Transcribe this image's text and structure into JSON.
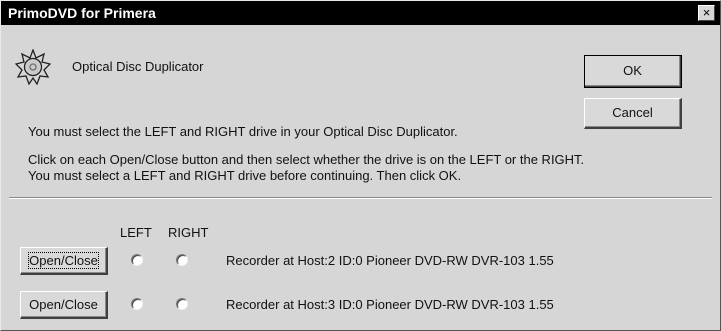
{
  "window": {
    "title": "PrimoDVD for Primera",
    "close_glyph": "×"
  },
  "header": {
    "icon": "starburst-disc-icon",
    "label": "Optical Disc Duplicator"
  },
  "buttons": {
    "ok": "OK",
    "cancel": "Cancel"
  },
  "messages": {
    "line1": "You must select the LEFT and RIGHT drive in your Optical Disc Duplicator.",
    "line2": "Click on each Open/Close button and then select whether the drive is on the LEFT or the RIGHT.",
    "line3": "You must select a LEFT and RIGHT drive before continuing.  Then click OK."
  },
  "columns": {
    "left": "LEFT",
    "right": "RIGHT"
  },
  "drives": [
    {
      "button": "Open/Close",
      "label": "Recorder at Host:2 ID:0  Pioneer DVD-RW DVR-103 1.55",
      "left_selected": false,
      "right_selected": false
    },
    {
      "button": "Open/Close",
      "label": "Recorder at Host:3 ID:0  Pioneer DVD-RW DVR-103 1.55",
      "left_selected": false,
      "right_selected": false
    }
  ],
  "colors": {
    "titlebar": "#000000",
    "dialog_bg": "#d6d6d6"
  }
}
